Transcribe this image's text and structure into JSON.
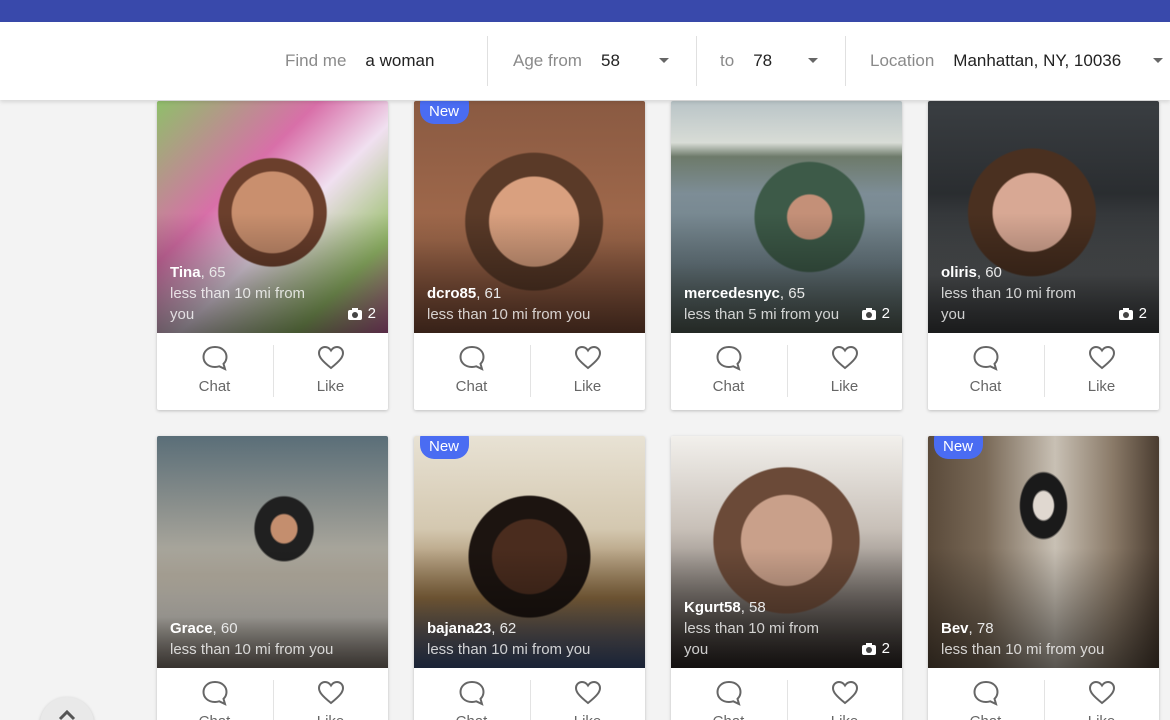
{
  "filters": {
    "find_label": "Find me",
    "find_value": "a woman",
    "age_from_label": "Age from",
    "age_from_value": "58",
    "age_to_label": "to",
    "age_to_value": "78",
    "location_label": "Location",
    "location_value": "Manhattan, NY, 10036"
  },
  "actions": {
    "chat_label": "Chat",
    "like_label": "Like"
  },
  "badge_new": "New",
  "profiles": [
    {
      "name": "Tina",
      "age": "65",
      "distance": "less than 10 mi from you",
      "photos": "2",
      "is_new": false
    },
    {
      "name": "dcro85",
      "age": "61",
      "distance": "less than 10 mi from you",
      "photos": "",
      "is_new": true
    },
    {
      "name": "mercedesnyc",
      "age": "65",
      "distance": "less than 5 mi from you",
      "photos": "2",
      "is_new": false
    },
    {
      "name": "oliris",
      "age": "60",
      "distance": "less than 10 mi from you",
      "photos": "2",
      "is_new": false
    },
    {
      "name": "Grace",
      "age": "60",
      "distance": "less than 10 mi from you",
      "photos": "",
      "is_new": false
    },
    {
      "name": "bajana23",
      "age": "62",
      "distance": "less than 10 mi from you",
      "photos": "",
      "is_new": true
    },
    {
      "name": "Kgurt58",
      "age": "58",
      "distance": "less than 10 mi from you",
      "photos": "2",
      "is_new": false
    },
    {
      "name": "Bev",
      "age": "78",
      "distance": "less than 10 mi from you",
      "photos": "",
      "is_new": true
    }
  ],
  "colors": {
    "header": "#3949ab",
    "badge": "#4a6cf2"
  }
}
